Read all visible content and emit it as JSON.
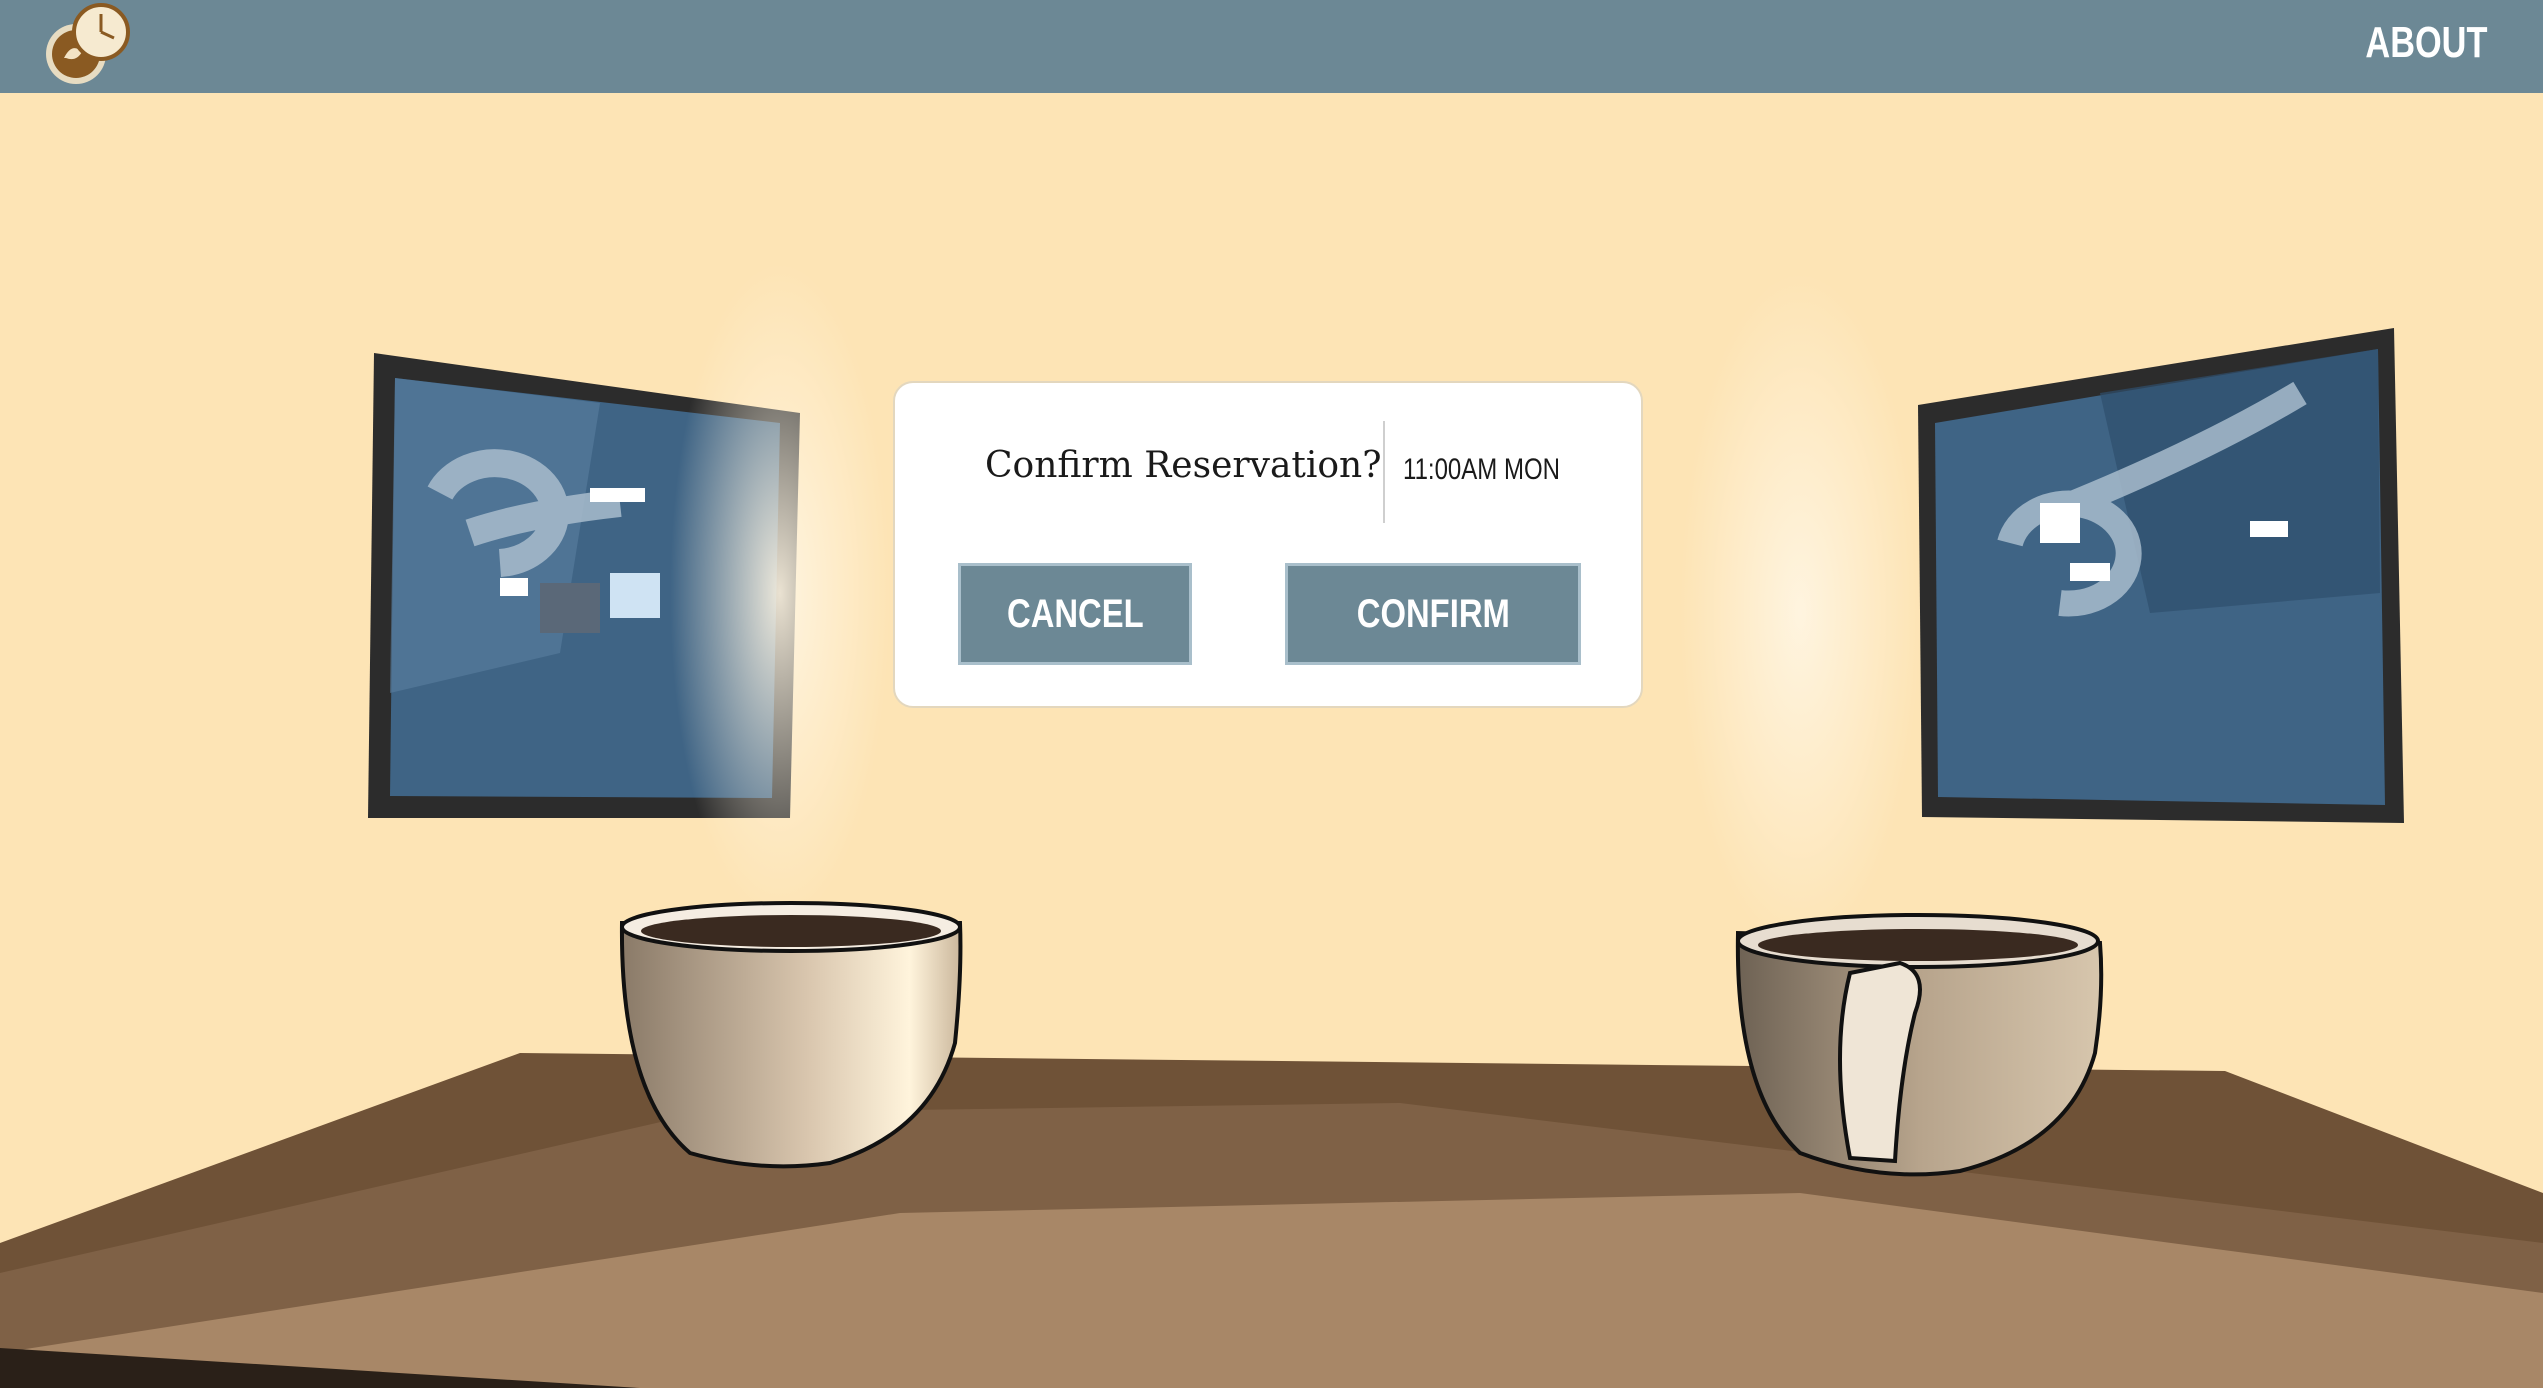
{
  "header": {
    "logo_icon": "coffee-clock-icon",
    "about_label": "ABOUT"
  },
  "colors": {
    "topbar": "#6c8895",
    "wall": "#fde4b5",
    "table": "#7a5c40",
    "button": "#6c8895",
    "button_border": "#a9bfcb"
  },
  "dialog": {
    "title": "Confirm Reservation?",
    "time": "11:00AM MON",
    "cancel_label": "CANCEL",
    "confirm_label": "CONFIRM"
  }
}
